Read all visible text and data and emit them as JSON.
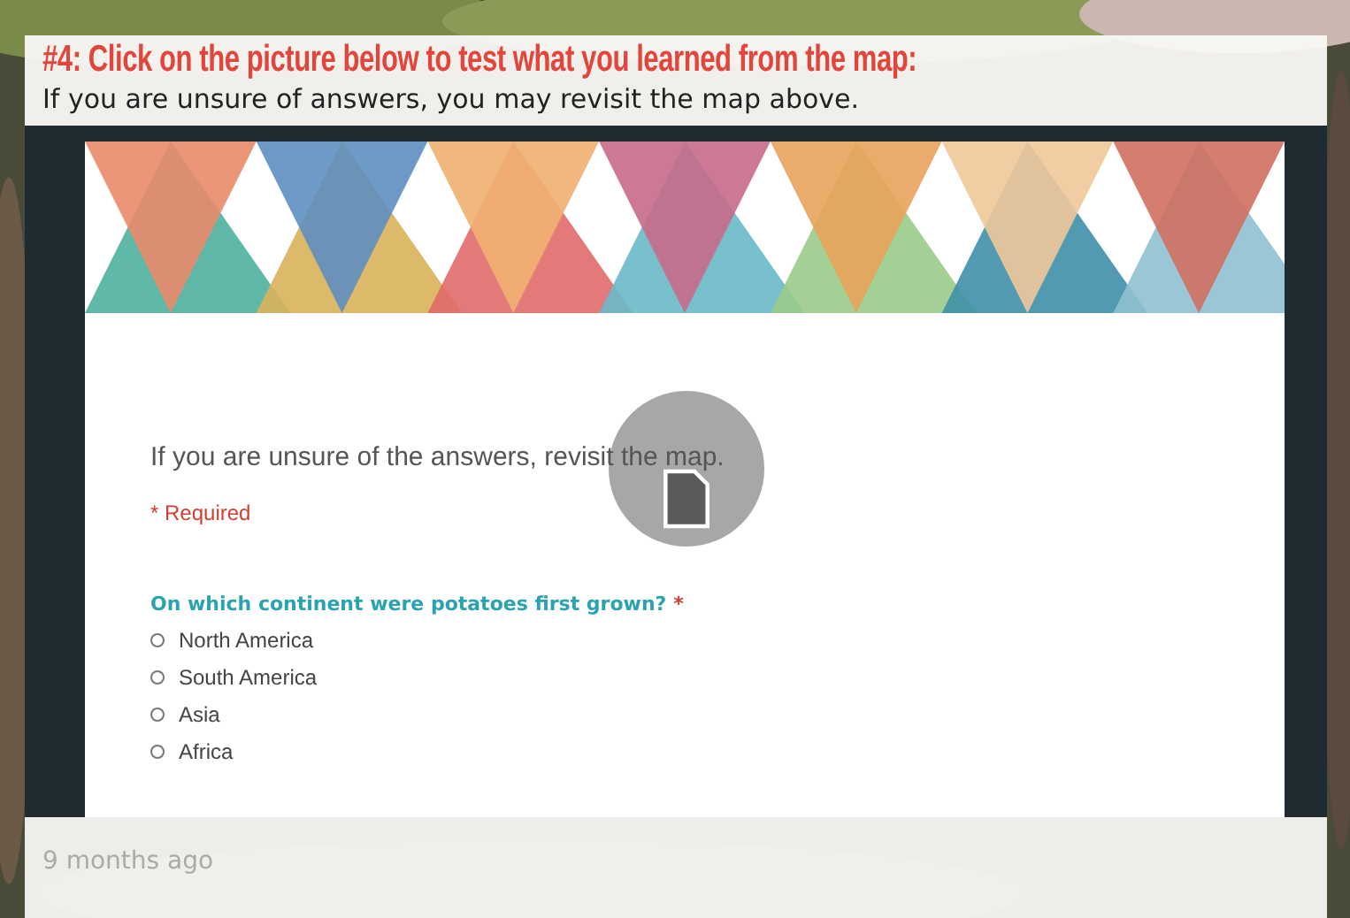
{
  "header": {
    "title": "#4: Click on the picture below to test what you learned from the map:",
    "subtitle": "If you are unsure of answers, you may revisit the map above."
  },
  "form": {
    "description": "If you are unsure of the answers, revisit the map.",
    "required_note": "* Required",
    "question": {
      "text": "On which continent were potatoes first grown?",
      "required_mark": "*",
      "options": [
        {
          "label": "North America",
          "selected": false
        },
        {
          "label": "South America",
          "selected": false
        },
        {
          "label": "Asia",
          "selected": false
        },
        {
          "label": "Africa",
          "selected": false
        }
      ]
    }
  },
  "footer": {
    "timestamp": "9 months ago"
  }
}
